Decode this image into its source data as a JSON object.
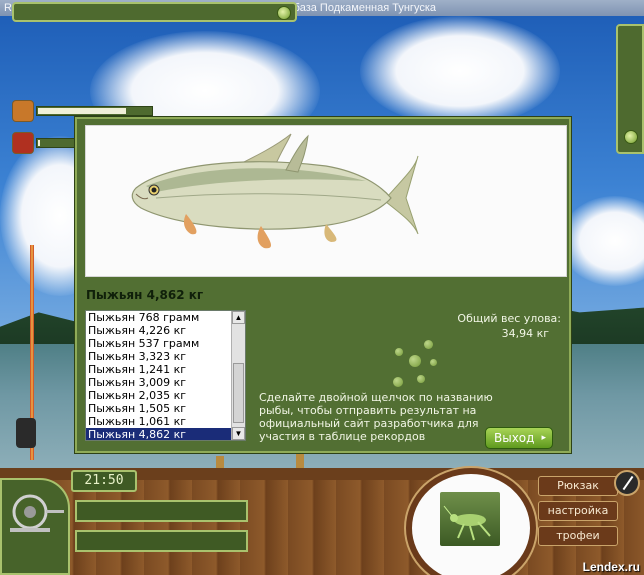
{
  "window": {
    "title": "Russian Fishing. Copyright by Fish Software. Рыболовная база Подкаменная Тунгуска"
  },
  "status_bars": [
    {
      "icon": "bait-icon",
      "fill": 0.77
    },
    {
      "icon": "energy-icon",
      "fill": 0.02
    }
  ],
  "dialog": {
    "fish_title": "Пыжьян 4,862 кг",
    "catch_list": [
      "Пыжьян 768 грамм",
      "Пыжьян 4,226 кг",
      "Пыжьян 537 грамм",
      "Пыжьян 3,323 кг",
      "Пыжьян 1,241 кг",
      "Пыжьян 3,009 кг",
      "Пыжьян 2,035 кг",
      "Пыжьян 1,505 кг",
      "Пыжьян 1,061 кг",
      "Пыжьян 4,862 кг"
    ],
    "selected_index": 9,
    "total_weight_label": "Общий вес улова:",
    "total_weight_value": "34,94 кг",
    "hint": "Сделайте двойной щелчок по названию рыбы, чтобы отправить результат на официальный сайт разработчика для участия в таблице рекордов",
    "exit_label": "Выход",
    "exit_arrow": "▸"
  },
  "hud": {
    "clock": "21:50",
    "menu": {
      "backpack": "Рюкзак",
      "settings": "настройка",
      "trophies": "трофеи"
    }
  },
  "watermark": "Lendex.ru",
  "colors": {
    "panel_green": "#526f33",
    "panel_border": "#8fab58",
    "selection": "#1a2c78",
    "menu_brown": "#6b3a1a"
  }
}
